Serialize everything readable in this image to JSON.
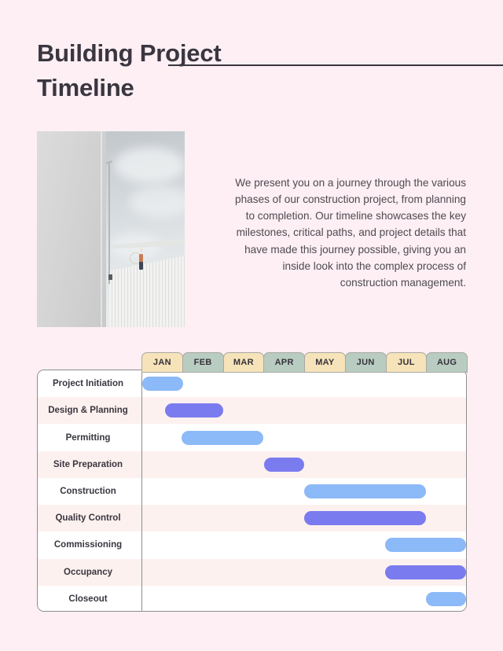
{
  "header": {
    "title": "Building Project\nTimeline"
  },
  "intro": {
    "paragraph": "We present you on a journey through the various phases of our construction project, from planning to completion. Our timeline showcases the key milestones, critical paths, and project details that have made this journey possible, giving you an inside look into the complex process of construction management."
  },
  "photo": {
    "alt": "Construction worker standing on the edge of a white corrugated metal roof beside a tall concrete wall under a cloudy sky"
  },
  "colors": {
    "background": "#fdeff3",
    "title": "#3a3640",
    "month_cream": "#f6e3b9",
    "month_sage": "#b9ccc1",
    "bar_light": "#8cb9f7",
    "bar_deep": "#7b7bf0",
    "row_stripe": "#fdf1ef",
    "row_plain": "#ffffff",
    "border": "#8d8d8d"
  },
  "chart_data": {
    "type": "bar",
    "title": "Building Project Timeline",
    "xlabel": "",
    "ylabel": "",
    "grid": false,
    "legend": null,
    "orientation": "horizontal-gantt",
    "categories": [
      "JAN",
      "FEB",
      "MAR",
      "APR",
      "MAY",
      "JUN",
      "JUL",
      "AUG"
    ],
    "month_styles": [
      "cream",
      "sage",
      "cream",
      "sage",
      "cream",
      "sage",
      "cream",
      "sage"
    ],
    "xlim": [
      0,
      8
    ],
    "tasks": [
      {
        "label": "Project Initiation",
        "start": 0.0,
        "end": 1.0,
        "start_month": "JAN",
        "end_month": "JAN",
        "color": "light",
        "stripe": "odd"
      },
      {
        "label": "Design & Planning",
        "start": 0.56,
        "end": 2.0,
        "start_month": "JAN",
        "end_month": "FEB",
        "color": "deep",
        "stripe": "even"
      },
      {
        "label": "Permitting",
        "start": 0.98,
        "end": 3.0,
        "start_month": "FEB",
        "end_month": "MAR",
        "color": "light",
        "stripe": "odd"
      },
      {
        "label": "Site Preparation",
        "start": 3.0,
        "end": 4.0,
        "start_month": "APR",
        "end_month": "APR",
        "color": "deep",
        "stripe": "even"
      },
      {
        "label": "Construction",
        "start": 4.0,
        "end": 7.0,
        "start_month": "MAY",
        "end_month": "JUL",
        "color": "light",
        "stripe": "odd"
      },
      {
        "label": "Quality Control",
        "start": 4.0,
        "end": 7.0,
        "start_month": "MAY",
        "end_month": "JUL",
        "color": "deep",
        "stripe": "even"
      },
      {
        "label": "Commissioning",
        "start": 6.0,
        "end": 8.0,
        "start_month": "JUL",
        "end_month": "AUG",
        "color": "light",
        "stripe": "odd"
      },
      {
        "label": "Occupancy",
        "start": 6.0,
        "end": 8.0,
        "start_month": "JUL",
        "end_month": "AUG",
        "color": "deep",
        "stripe": "even"
      },
      {
        "label": "Closeout",
        "start": 7.0,
        "end": 8.0,
        "start_month": "AUG",
        "end_month": "AUG",
        "color": "light",
        "stripe": "odd"
      }
    ]
  }
}
